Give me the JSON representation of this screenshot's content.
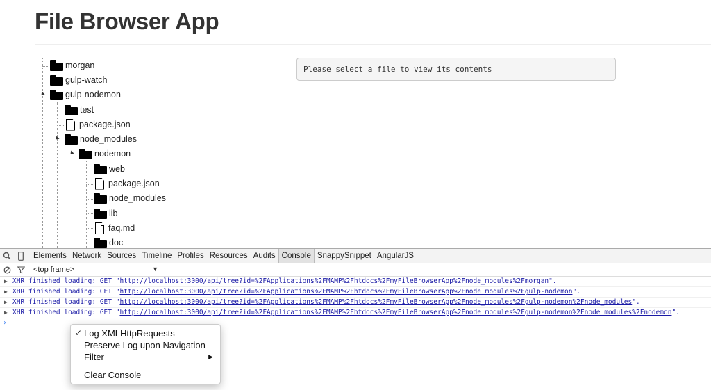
{
  "app": {
    "title": "File Browser App"
  },
  "tree": {
    "items": [
      {
        "name": "morgan",
        "type": "folder"
      },
      {
        "name": "gulp-watch",
        "type": "folder"
      },
      {
        "name": "gulp-nodemon",
        "type": "folder",
        "expanded": true
      },
      {
        "name": "test",
        "type": "folder"
      },
      {
        "name": "package.json",
        "type": "file"
      },
      {
        "name": "node_modules",
        "type": "folder",
        "expanded": true
      },
      {
        "name": "nodemon",
        "type": "folder",
        "expanded": true
      },
      {
        "name": "web",
        "type": "folder"
      },
      {
        "name": "package.json",
        "type": "file"
      },
      {
        "name": "node_modules",
        "type": "folder"
      },
      {
        "name": "lib",
        "type": "folder"
      },
      {
        "name": "faq.md",
        "type": "file"
      },
      {
        "name": "doc",
        "type": "folder"
      }
    ]
  },
  "viewer": {
    "placeholder": "Please select a file to view its contents"
  },
  "devtools": {
    "tabs": [
      "Elements",
      "Network",
      "Sources",
      "Timeline",
      "Profiles",
      "Resources",
      "Audits",
      "Console",
      "SnappySnippet",
      "AngularJS"
    ],
    "active_tab": "Console",
    "frame_selector": "<top frame>",
    "log": [
      {
        "prefix": "XHR finished loading: GET \"",
        "url": "http://localhost:3000/api/tree?id=%2FApplications%2FMAMP%2Fhtdocs%2FmyFileBrowserApp%2Fnode_modules%2Fmorgan",
        "suffix": "\"."
      },
      {
        "prefix": "XHR finished loading: GET \"",
        "url": "http://localhost:3000/api/tree?id=%2FApplications%2FMAMP%2Fhtdocs%2FmyFileBrowserApp%2Fnode_modules%2Fgulp-nodemon",
        "suffix": "\"."
      },
      {
        "prefix": "XHR finished loading: GET \"",
        "url": "http://localhost:3000/api/tree?id=%2FApplications%2FMAMP%2Fhtdocs%2FmyFileBrowserApp%2Fnode_modules%2Fgulp-nodemon%2Fnode_modules",
        "suffix": "\"."
      },
      {
        "prefix": "XHR finished loading: GET \"",
        "url": "http://localhost:3000/api/tree?id=%2FApplications%2FMAMP%2Fhtdocs%2FmyFileBrowserApp%2Fnode_modules%2Fgulp-nodemon%2Fnode_modules%2Fnodemon",
        "suffix": "\"."
      }
    ],
    "prompt": "›"
  },
  "context_menu": {
    "items": [
      {
        "label": "Log XMLHttpRequests",
        "checked": true,
        "check_glyph": "✓"
      },
      {
        "label": "Preserve Log upon Navigation"
      },
      {
        "label": "Filter",
        "submenu_glyph": "▶"
      },
      {
        "label": "Clear Console"
      }
    ]
  }
}
